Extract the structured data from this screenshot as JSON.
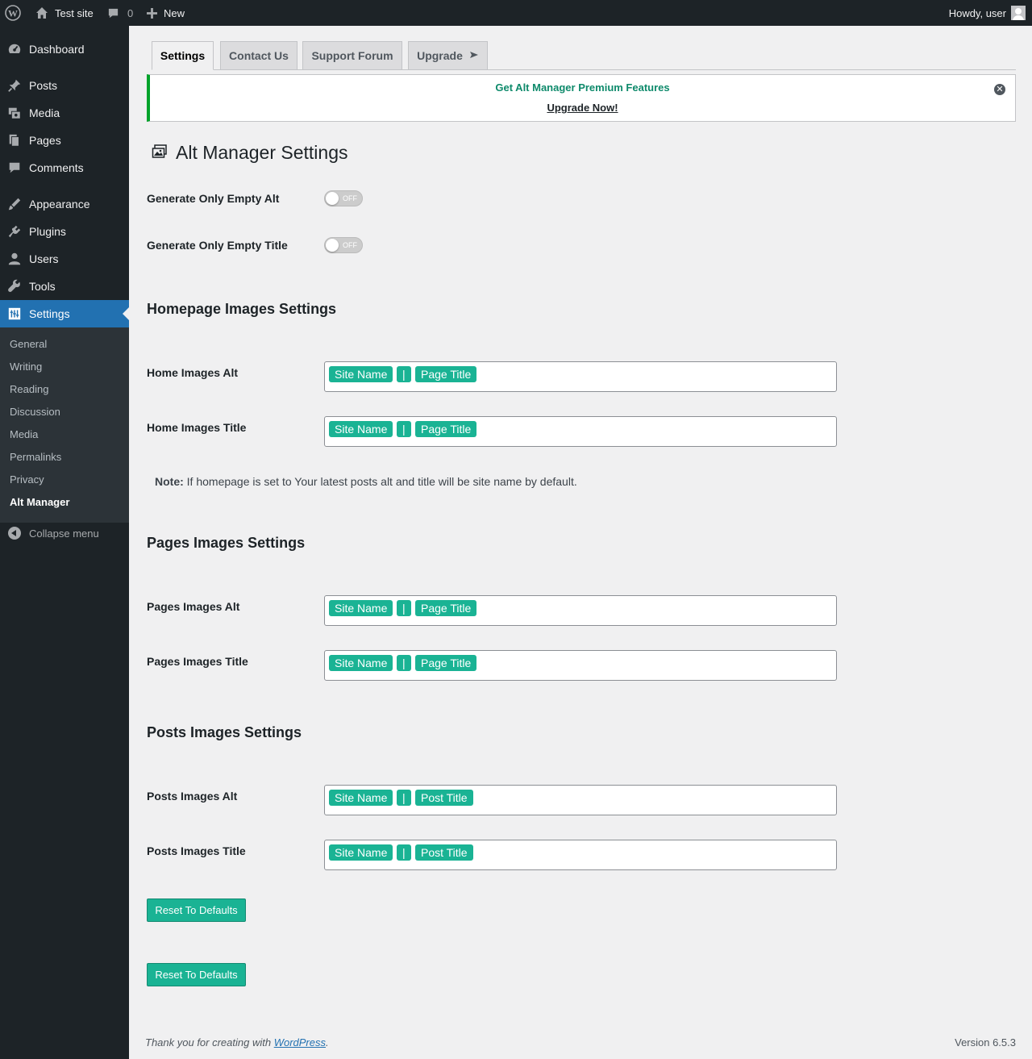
{
  "adminbar": {
    "site_name": "Test site",
    "comments_count": "0",
    "new_label": "New",
    "howdy": "Howdy, user"
  },
  "sidebar": {
    "items": [
      {
        "label": "Dashboard",
        "icon": "dashboard-icon"
      },
      {
        "label": "Posts",
        "icon": "pin-icon"
      },
      {
        "label": "Media",
        "icon": "media-icon"
      },
      {
        "label": "Pages",
        "icon": "pages-icon"
      },
      {
        "label": "Comments",
        "icon": "comment-icon"
      },
      {
        "label": "Appearance",
        "icon": "brush-icon"
      },
      {
        "label": "Plugins",
        "icon": "plug-icon"
      },
      {
        "label": "Users",
        "icon": "user-icon"
      },
      {
        "label": "Tools",
        "icon": "wrench-icon"
      },
      {
        "label": "Settings",
        "icon": "settings-icon"
      }
    ],
    "submenu": [
      "General",
      "Writing",
      "Reading",
      "Discussion",
      "Media",
      "Permalinks",
      "Privacy",
      "Alt Manager"
    ],
    "collapse_label": "Collapse menu"
  },
  "tabs": [
    "Settings",
    "Contact Us",
    "Support Forum",
    "Upgrade"
  ],
  "notice": {
    "title": "Get Alt Manager Premium Features",
    "link": "Upgrade Now!"
  },
  "page_title": "Alt Manager Settings",
  "toggles": [
    {
      "label": "Generate Only Empty Alt",
      "state": "OFF"
    },
    {
      "label": "Generate Only Empty Title",
      "state": "OFF"
    }
  ],
  "sections": {
    "homepage": {
      "title": "Homepage Images Settings",
      "alt_label": "Home Images Alt",
      "title_label": "Home Images Title",
      "alt_tags": [
        "Site Name",
        "|",
        "Page Title"
      ],
      "title_tags": [
        "Site Name",
        "|",
        "Page Title"
      ]
    },
    "pages": {
      "title": "Pages Images Settings",
      "alt_label": "Pages Images Alt",
      "title_label": "Pages Images Title",
      "alt_tags": [
        "Site Name",
        "|",
        "Page Title"
      ],
      "title_tags": [
        "Site Name",
        "|",
        "Page Title"
      ]
    },
    "posts": {
      "title": "Posts Images Settings",
      "alt_label": "Posts Images Alt",
      "title_label": "Posts Images Title",
      "alt_tags": [
        "Site Name",
        "|",
        "Post Title"
      ],
      "title_tags": [
        "Site Name",
        "|",
        "Post Title"
      ]
    }
  },
  "note": {
    "bold": "Note:",
    "text": " If homepage is set to Your latest posts alt and title will be site name by default."
  },
  "buttons": {
    "reset": "Reset To Defaults"
  },
  "footer": {
    "thanks_prefix": "Thank you for creating with ",
    "wordpress_link": "WordPress",
    "thanks_suffix": ".",
    "version": "Version 6.5.3"
  },
  "colors": {
    "accent": "#2271b1",
    "tag_green": "#1ab394",
    "admin_dark": "#1d2327",
    "notice_green": "#00a32a"
  }
}
